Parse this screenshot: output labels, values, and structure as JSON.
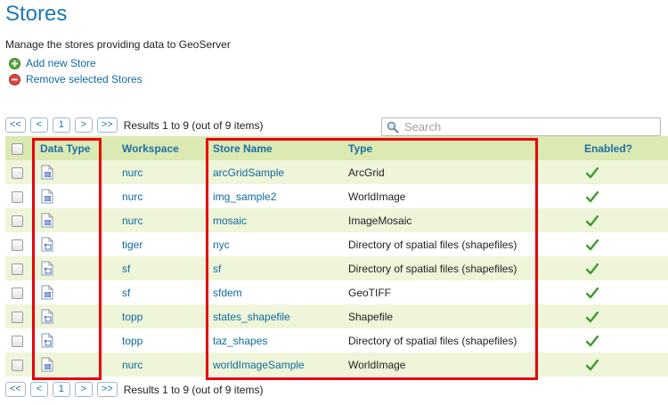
{
  "page": {
    "title": "Stores",
    "description": "Manage the stores providing data to GeoServer"
  },
  "actions": {
    "add": "Add new Store",
    "remove": "Remove selected Stores"
  },
  "pager": {
    "first": "<<",
    "prev": "<",
    "page": "1",
    "next": ">",
    "last": ">>",
    "info": "Results 1 to 9 (out of 9 items)"
  },
  "search": {
    "placeholder": "Search",
    "value": ""
  },
  "table": {
    "headers": {
      "data_type": "Data Type",
      "workspace": "Workspace",
      "store_name": "Store Name",
      "type": "Type",
      "enabled": "Enabled?"
    },
    "rows": [
      {
        "icon": "raster-icon",
        "workspace": "nurc",
        "store": "arcGridSample",
        "type": "ArcGrid",
        "enabled": true
      },
      {
        "icon": "raster-icon",
        "workspace": "nurc",
        "store": "img_sample2",
        "type": "WorldImage",
        "enabled": true
      },
      {
        "icon": "raster-icon",
        "workspace": "nurc",
        "store": "mosaic",
        "type": "ImageMosaic",
        "enabled": true
      },
      {
        "icon": "vector-icon",
        "workspace": "tiger",
        "store": "nyc",
        "type": "Directory of spatial files (shapefiles)",
        "enabled": true
      },
      {
        "icon": "vector-icon",
        "workspace": "sf",
        "store": "sf",
        "type": "Directory of spatial files (shapefiles)",
        "enabled": true
      },
      {
        "icon": "raster-icon",
        "workspace": "sf",
        "store": "sfdem",
        "type": "GeoTIFF",
        "enabled": true
      },
      {
        "icon": "vector-icon",
        "workspace": "topp",
        "store": "states_shapefile",
        "type": "Shapefile",
        "enabled": true
      },
      {
        "icon": "vector-icon",
        "workspace": "topp",
        "store": "taz_shapes",
        "type": "Directory of spatial files (shapefiles)",
        "enabled": true
      },
      {
        "icon": "raster-icon",
        "workspace": "nurc",
        "store": "worldImageSample",
        "type": "WorldImage",
        "enabled": true
      }
    ]
  },
  "colors": {
    "title": "#1d78b5",
    "link": "#0f6a9d",
    "header_bg": "#dbe9b2",
    "row_alt_bg": "#eef5d9",
    "highlight": "#e8000b",
    "check": "#3f9a2b"
  }
}
